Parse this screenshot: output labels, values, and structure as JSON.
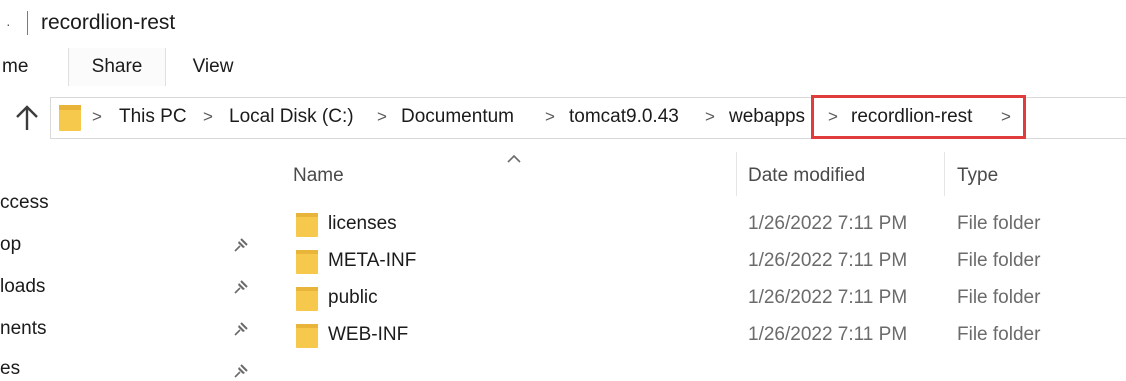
{
  "window": {
    "title_edge": "·",
    "title": "recordlion-rest"
  },
  "ribbon": {
    "tabs": [
      "me",
      "Share",
      "View"
    ]
  },
  "address": {
    "crumbs": [
      "This PC",
      "Local Disk (C:)",
      "Documentum",
      "tomcat9.0.43",
      "webapps",
      "recordlion-rest"
    ],
    "separator": ">",
    "trailing_separator": ">",
    "highlight_color": "#e03c3c",
    "folder_color": "#f6c84c"
  },
  "nav": {
    "items": [
      {
        "label": "ccess",
        "pinned": false
      },
      {
        "label": "op",
        "pinned": true
      },
      {
        "label": "loads",
        "pinned": true
      },
      {
        "label": "nents",
        "pinned": true
      },
      {
        "label": "es",
        "pinned": true
      }
    ]
  },
  "list": {
    "sort_indicator": "^",
    "columns": {
      "name": "Name",
      "date": "Date modified",
      "type": "Type"
    },
    "rows": [
      {
        "name": "licenses",
        "date": "1/26/2022 7:11 PM",
        "type": "File folder"
      },
      {
        "name": "META-INF",
        "date": "1/26/2022 7:11 PM",
        "type": "File folder"
      },
      {
        "name": "public",
        "date": "1/26/2022 7:11 PM",
        "type": "File folder"
      },
      {
        "name": "WEB-INF",
        "date": "1/26/2022 7:11 PM",
        "type": "File folder"
      }
    ]
  }
}
